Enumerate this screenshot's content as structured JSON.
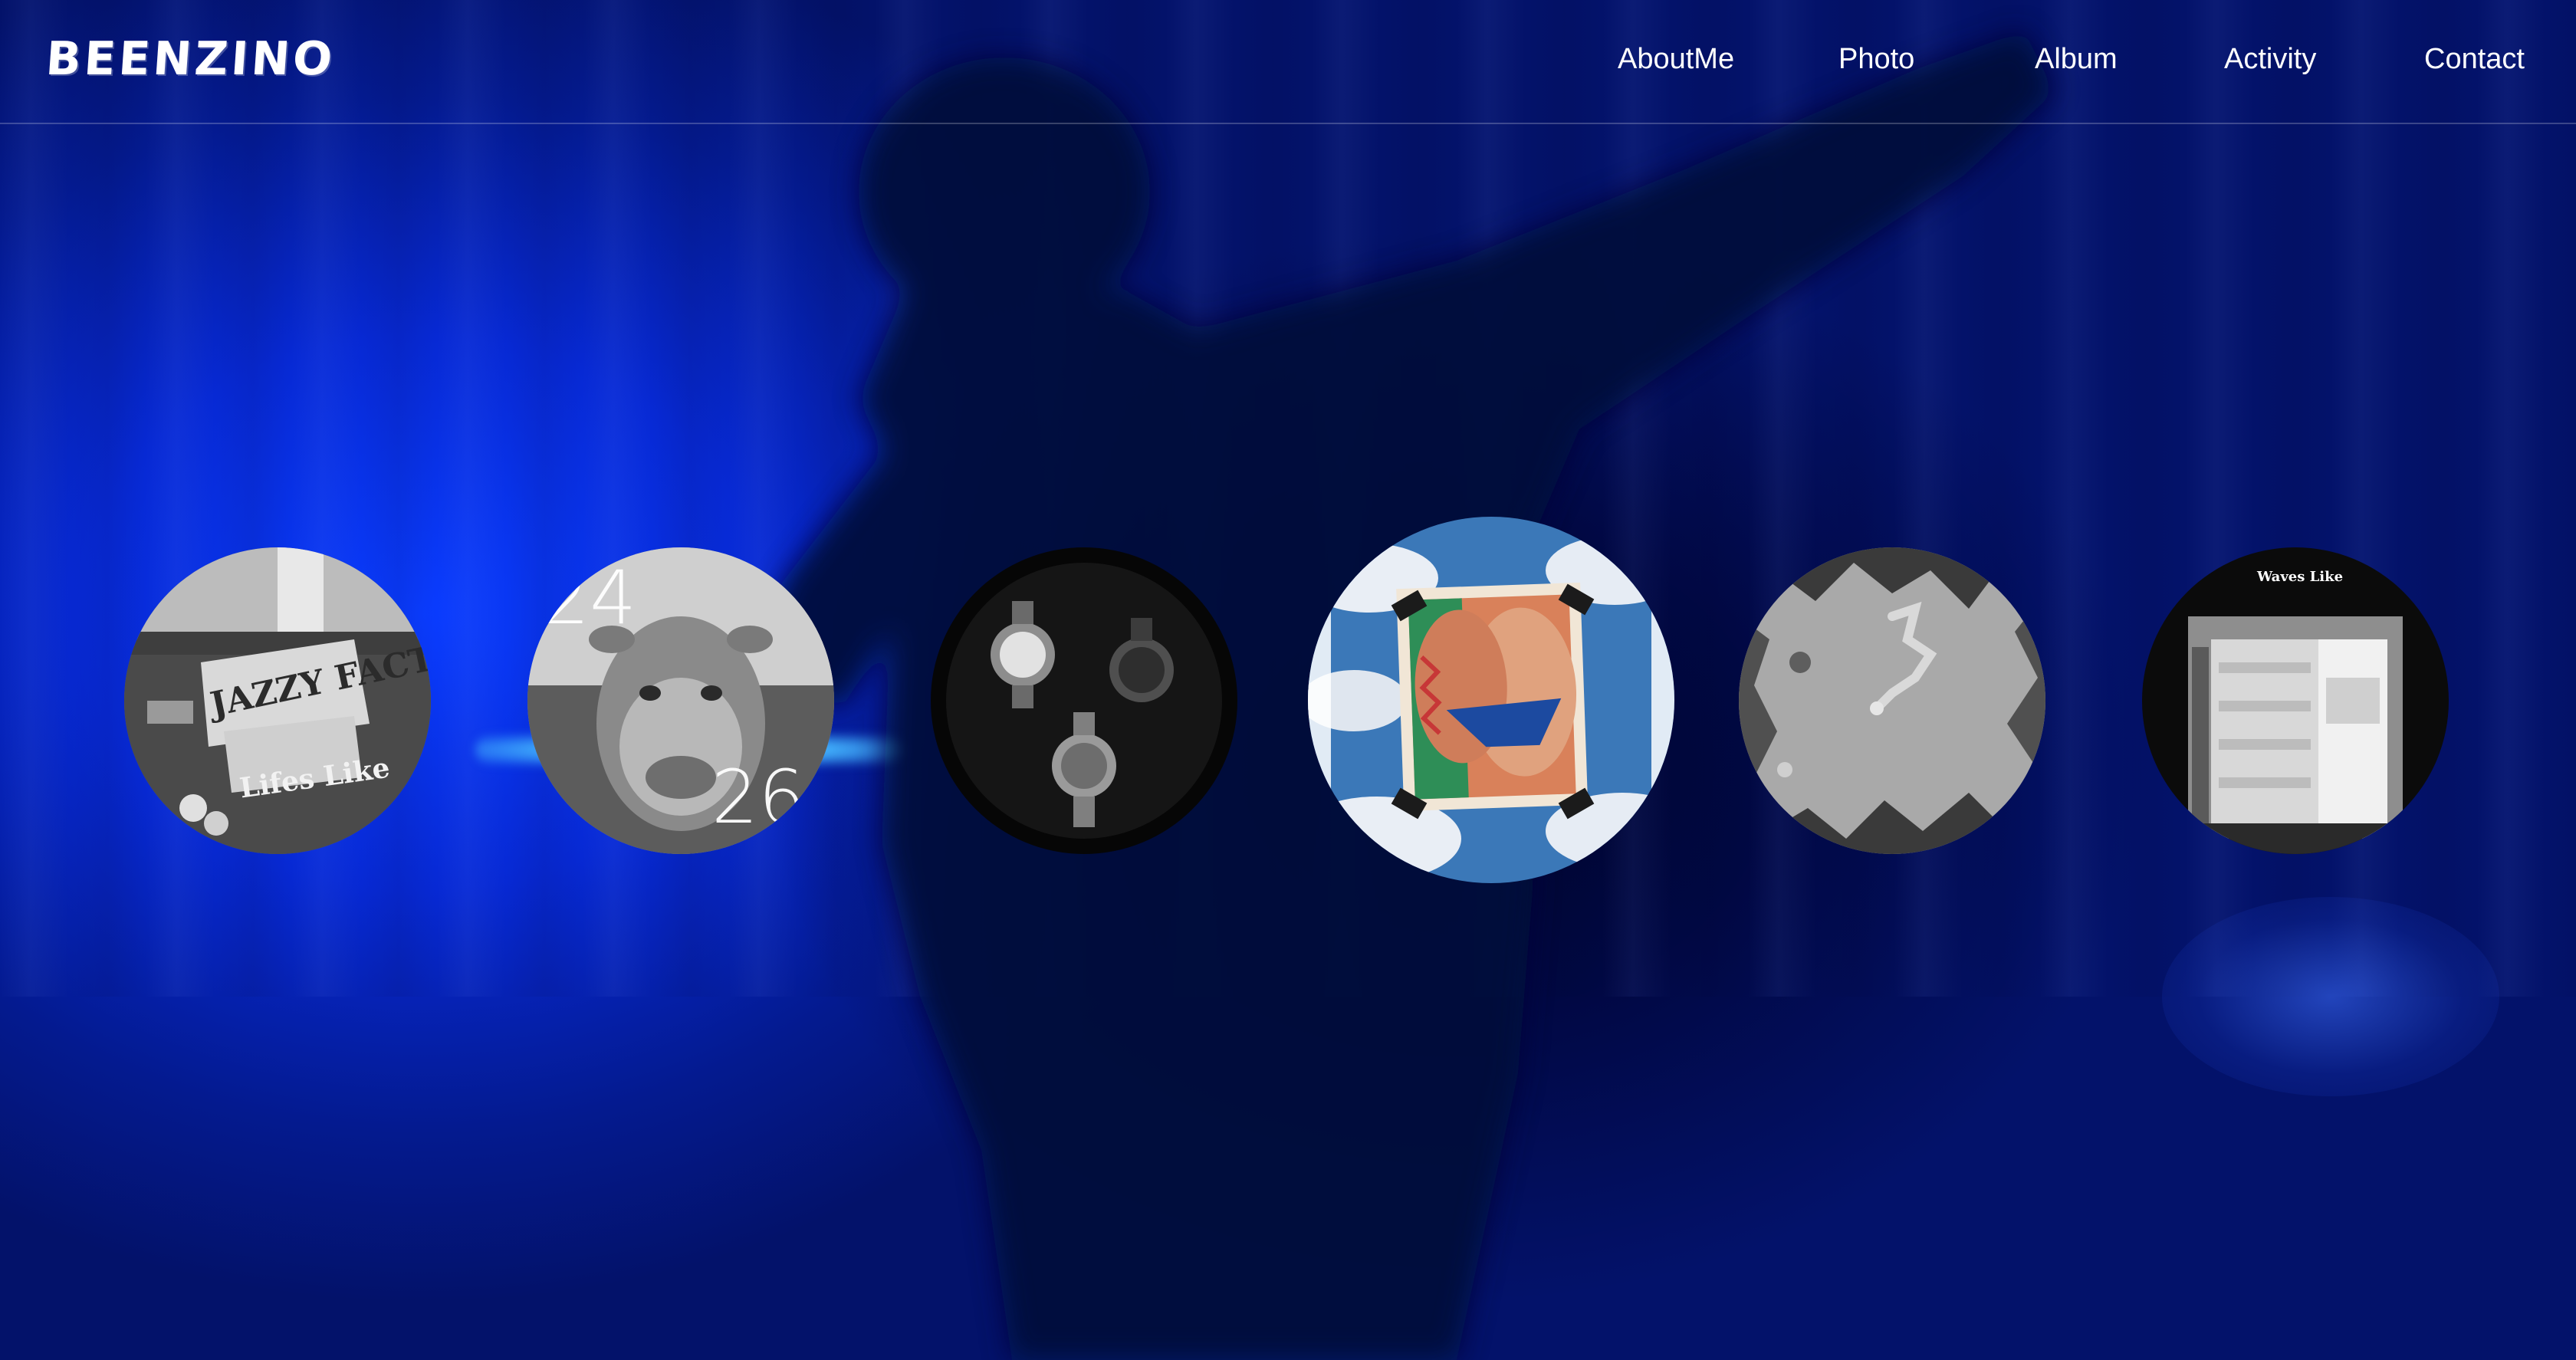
{
  "brand": {
    "logo": "BEENZINO"
  },
  "nav": {
    "items": [
      {
        "label": "AboutMe"
      },
      {
        "label": "Photo"
      },
      {
        "label": "Album"
      },
      {
        "label": "Activity"
      },
      {
        "label": "Contact"
      }
    ]
  },
  "albums": [
    {
      "icon": "jazzy-fact-cover-image",
      "cover_text": "JAZZY FACT",
      "cover_subtext": "Lifes Like"
    },
    {
      "icon": "camel-cover-image",
      "cover_text_top": "24",
      "cover_text_bottom": "26"
    },
    {
      "icon": "watches-cover-image"
    },
    {
      "icon": "painting-cover-image",
      "active": true
    },
    {
      "icon": "island-map-cover-image"
    },
    {
      "icon": "building-cover-image",
      "cover_text": "Waves Like"
    }
  ],
  "colors": {
    "background": "#0624b8",
    "accent_glow": "#43b4ff",
    "text": "#ffffff"
  }
}
